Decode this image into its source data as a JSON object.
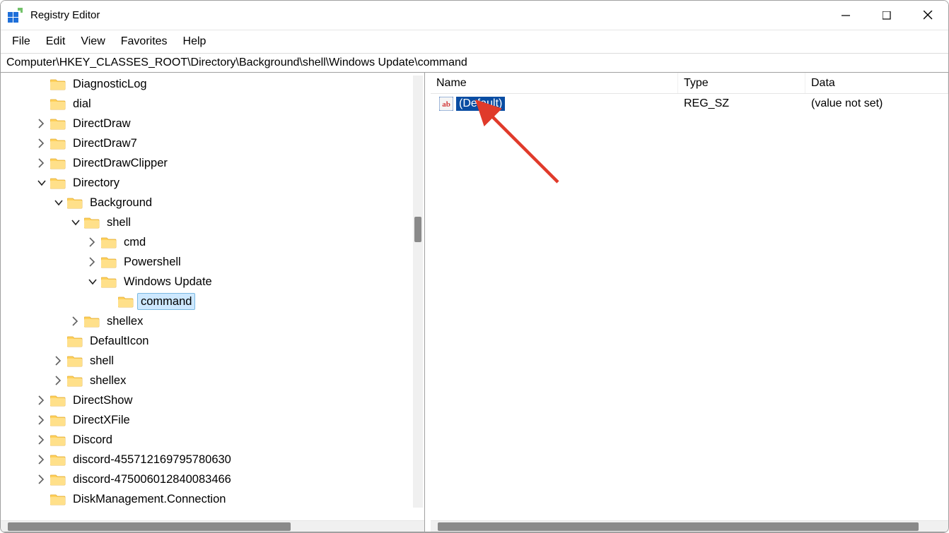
{
  "window": {
    "title": "Registry Editor"
  },
  "menu": {
    "file": "File",
    "edit": "Edit",
    "view": "View",
    "favorites": "Favorites",
    "help": "Help"
  },
  "address": "Computer\\HKEY_CLASSES_ROOT\\Directory\\Background\\shell\\Windows Update\\command",
  "tree": [
    {
      "indent": 1,
      "chevron": "none",
      "label": "DiagnosticLog",
      "selected": false
    },
    {
      "indent": 1,
      "chevron": "none",
      "label": "dial",
      "selected": false
    },
    {
      "indent": 1,
      "chevron": "right",
      "label": "DirectDraw",
      "selected": false
    },
    {
      "indent": 1,
      "chevron": "right",
      "label": "DirectDraw7",
      "selected": false
    },
    {
      "indent": 1,
      "chevron": "right",
      "label": "DirectDrawClipper",
      "selected": false
    },
    {
      "indent": 1,
      "chevron": "down",
      "label": "Directory",
      "selected": false
    },
    {
      "indent": 2,
      "chevron": "down",
      "label": "Background",
      "selected": false
    },
    {
      "indent": 3,
      "chevron": "down",
      "label": "shell",
      "selected": false
    },
    {
      "indent": 4,
      "chevron": "right",
      "label": "cmd",
      "selected": false
    },
    {
      "indent": 4,
      "chevron": "right",
      "label": "Powershell",
      "selected": false
    },
    {
      "indent": 4,
      "chevron": "down",
      "label": "Windows Update",
      "selected": false
    },
    {
      "indent": 5,
      "chevron": "none",
      "label": "command",
      "selected": true
    },
    {
      "indent": 3,
      "chevron": "right",
      "label": "shellex",
      "selected": false
    },
    {
      "indent": 2,
      "chevron": "none",
      "label": "DefaultIcon",
      "selected": false
    },
    {
      "indent": 2,
      "chevron": "right",
      "label": "shell",
      "selected": false
    },
    {
      "indent": 2,
      "chevron": "right",
      "label": "shellex",
      "selected": false
    },
    {
      "indent": 1,
      "chevron": "right",
      "label": "DirectShow",
      "selected": false
    },
    {
      "indent": 1,
      "chevron": "right",
      "label": "DirectXFile",
      "selected": false
    },
    {
      "indent": 1,
      "chevron": "right",
      "label": "Discord",
      "selected": false
    },
    {
      "indent": 1,
      "chevron": "right",
      "label": "discord-455712169795780630",
      "selected": false
    },
    {
      "indent": 1,
      "chevron": "right",
      "label": "discord-475006012840083466",
      "selected": false
    },
    {
      "indent": 1,
      "chevron": "none",
      "label": "DiskManagement.Connection",
      "selected": false
    }
  ],
  "columns": {
    "name": "Name",
    "type": "Type",
    "data": "Data"
  },
  "values": [
    {
      "name": "(Default)",
      "type": "REG_SZ",
      "data": "(value not set)",
      "selected": true
    }
  ]
}
